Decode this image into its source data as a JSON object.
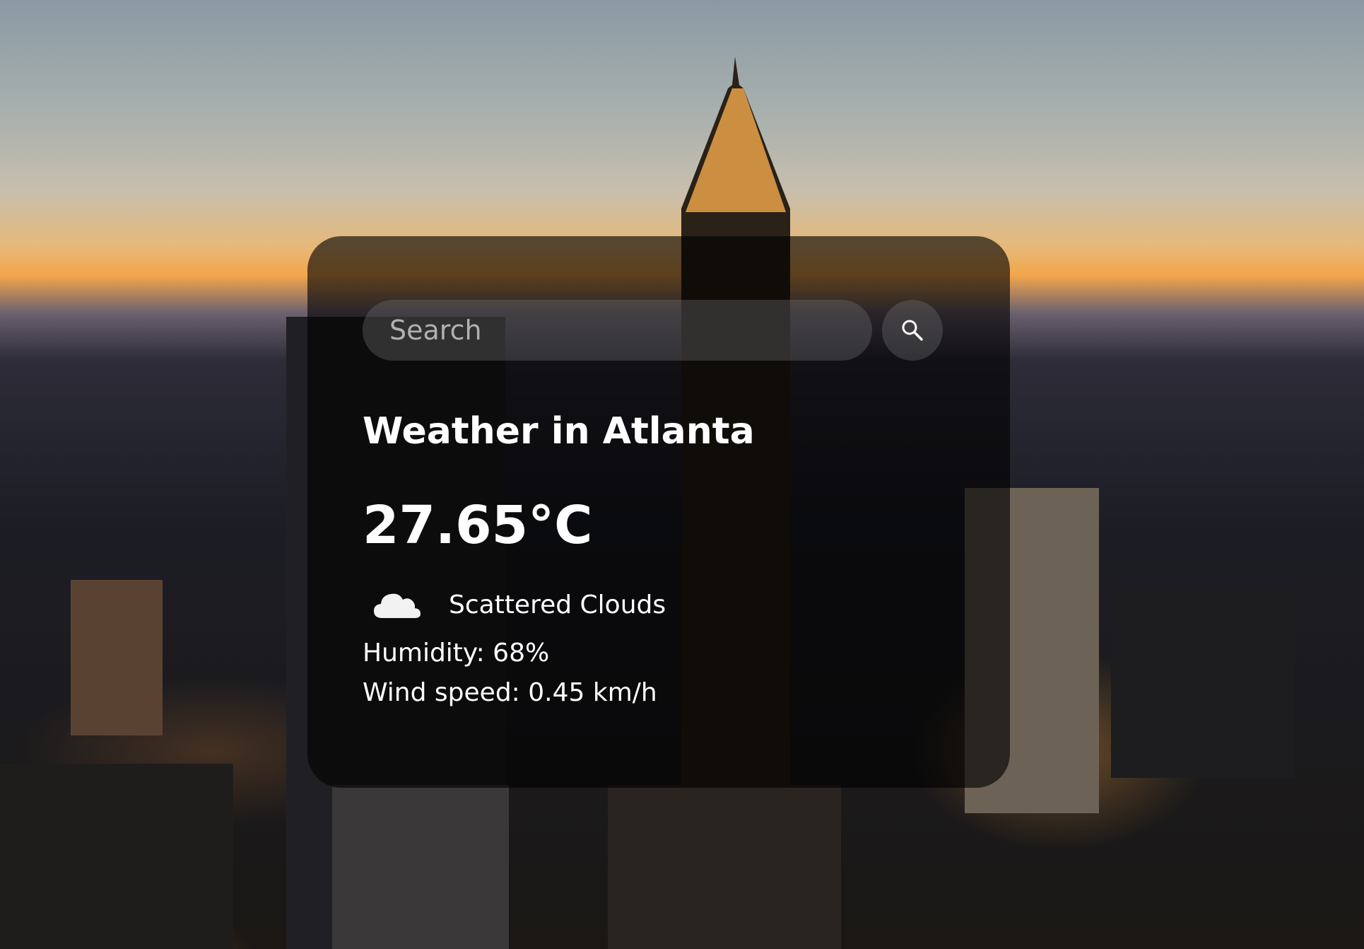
{
  "search": {
    "placeholder": "Search",
    "button_icon": "search-icon"
  },
  "weather": {
    "title": "Weather in Atlanta",
    "temperature": "27.65°C",
    "condition_icon": "cloud-icon",
    "description": "Scattered Clouds",
    "humidity": "Humidity: 68%",
    "wind": "Wind speed: 0.45 km/h"
  },
  "colors": {
    "card_background": "rgba(0,0,0,0.62)",
    "text": "#ffffff",
    "input_background": "rgba(125,125,125,0.32)"
  }
}
